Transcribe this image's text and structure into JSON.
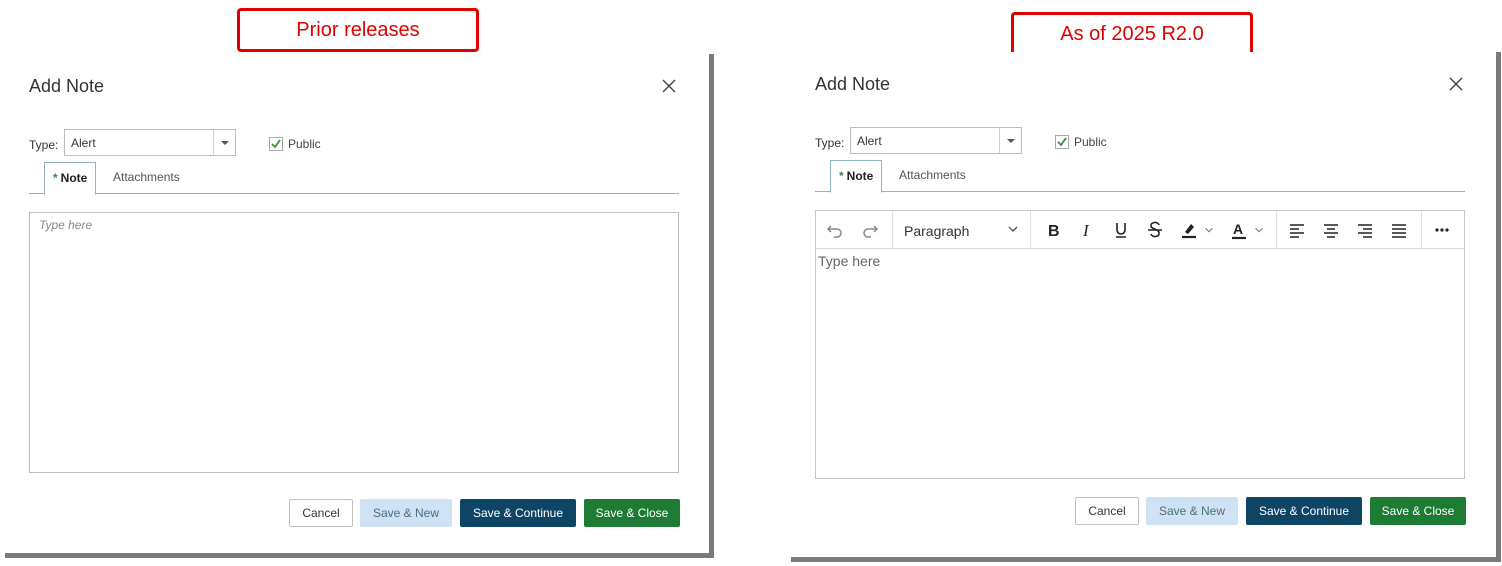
{
  "callouts": {
    "left": "Prior releases",
    "right": "As of 2025 R2.0"
  },
  "dialog_old": {
    "title": "Add Note",
    "type_label": "Type:",
    "type_value": "Alert",
    "public_label": "Public",
    "public_checked": true,
    "tabs": [
      {
        "label": "Note",
        "required": "*"
      },
      {
        "label": "Attachments"
      }
    ],
    "placeholder": "Type here",
    "buttons": {
      "cancel": "Cancel",
      "save_new": "Save & New",
      "save_continue": "Save & Continue",
      "save_close": "Save & Close"
    }
  },
  "dialog_new": {
    "title": "Add Note",
    "type_label": "Type:",
    "type_value": "Alert",
    "public_label": "Public",
    "public_checked": true,
    "tabs": [
      {
        "label": "Note",
        "required": "*"
      },
      {
        "label": "Attachments"
      }
    ],
    "toolbar": {
      "paragraph_label": "Paragraph",
      "icons": [
        "undo-icon",
        "redo-icon",
        "bold-icon",
        "italic-icon",
        "underline-icon",
        "strikethrough-icon",
        "highlight-icon",
        "font-color-icon",
        "align-left-icon",
        "align-center-icon",
        "align-right-icon",
        "justify-icon",
        "more-icon"
      ]
    },
    "placeholder": "Type here",
    "buttons": {
      "cancel": "Cancel",
      "save_new": "Save & New",
      "save_continue": "Save & Continue",
      "save_close": "Save & Close"
    }
  },
  "colors": {
    "callout_red": "#e00000",
    "save_continue_bg": "#0e4565",
    "save_close_bg": "#1e7b34",
    "save_new_bg": "#cfe2f3",
    "required_star": "#2e8b57"
  }
}
